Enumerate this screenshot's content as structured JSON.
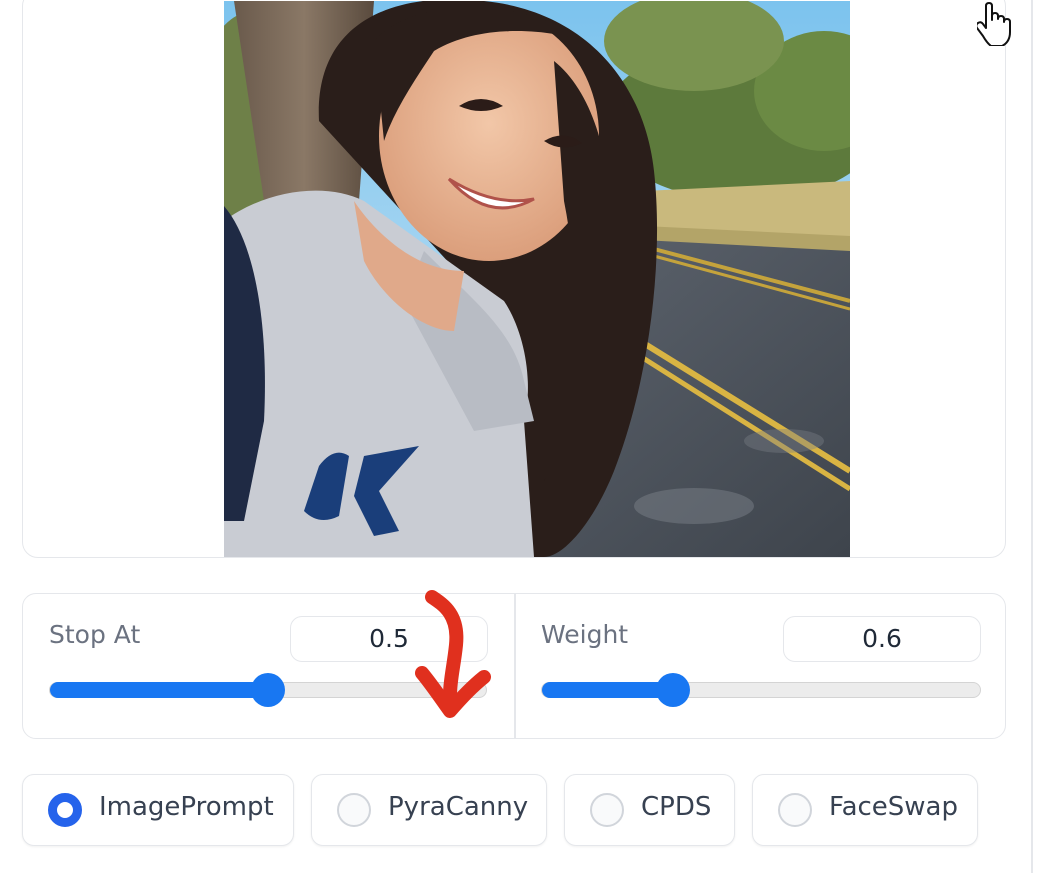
{
  "sliders": [
    {
      "label": "Stop At",
      "value": "0.5",
      "fraction": 0.5
    },
    {
      "label": "Weight",
      "value": "0.6",
      "fraction": 0.3
    }
  ],
  "radio_options": [
    {
      "label": "ImagePrompt",
      "checked": true
    },
    {
      "label": "PyraCanny",
      "checked": false
    },
    {
      "label": "CPDS",
      "checked": false
    },
    {
      "label": "FaceSwap",
      "checked": false
    }
  ],
  "colors": {
    "accent": "#1877f2",
    "radio_checked": "#2563eb",
    "annotation_arrow": "#e0301e",
    "border": "#e5e7eb"
  },
  "icons": {
    "cursor": "hand-pointer-icon",
    "annotation": "red-arrow-down-icon"
  }
}
